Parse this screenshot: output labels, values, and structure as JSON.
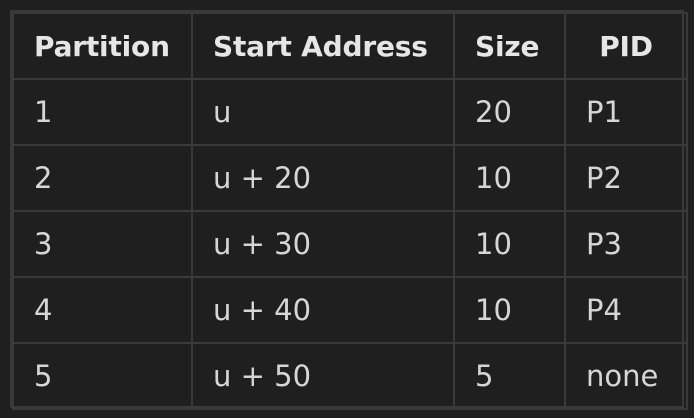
{
  "table": {
    "headers": [
      "Partition",
      "Start Address",
      "Size",
      "PID"
    ],
    "rows": [
      [
        "1",
        "u",
        "20",
        "P1"
      ],
      [
        "2",
        "u + 20",
        "10",
        "P2"
      ],
      [
        "3",
        "u + 30",
        "10",
        "P3"
      ],
      [
        "4",
        "u + 40",
        "10",
        "P4"
      ],
      [
        "5",
        "u + 50",
        "5",
        "none"
      ]
    ]
  }
}
